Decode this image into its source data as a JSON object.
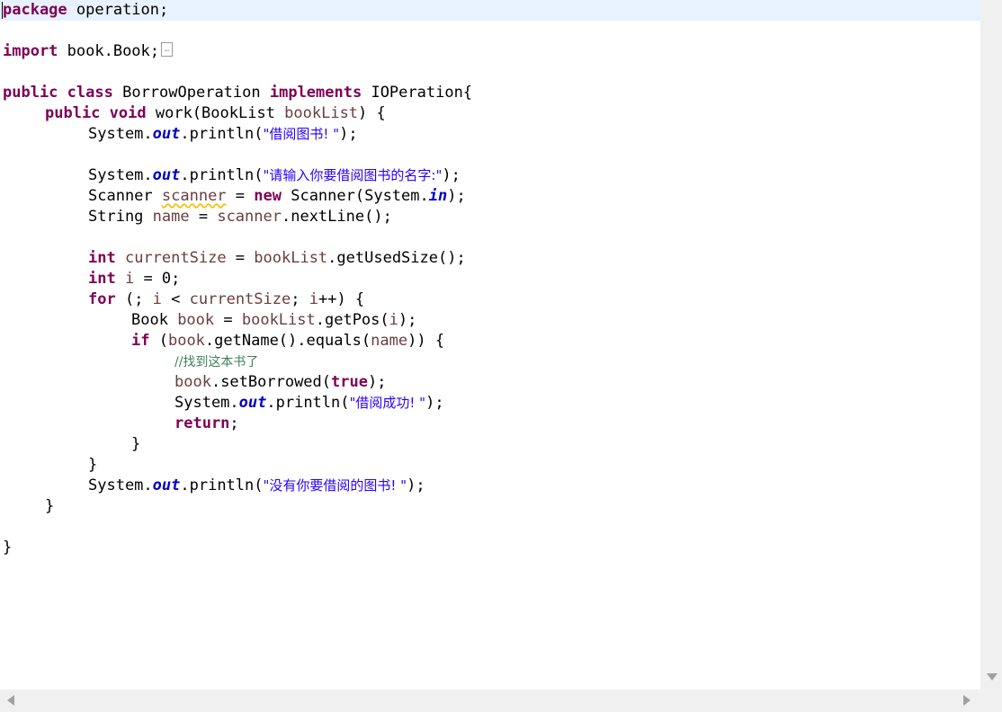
{
  "editor": {
    "l1": {
      "kw": "package",
      "rest": " operation;"
    },
    "l3": {
      "kw": "import",
      "rest": " book.Book;",
      "fold": "…"
    },
    "l5": {
      "kw1": "public",
      "kw2": "class",
      "name": " BorrowOperation ",
      "kw3": "implements",
      "rest": " IOPeration{"
    },
    "l6": {
      "kw1": "public",
      "kw2": "void",
      "a": " work(BookList ",
      "param": "bookList",
      "b": ") {"
    },
    "l7": {
      "a": "System.",
      "field": "out",
      "b": ".println(",
      "str": "\"借阅图书! \"",
      "c": ");"
    },
    "l9": {
      "a": "System.",
      "field": "out",
      "b": ".println(",
      "str": "\"请输入你要借阅图书的名字:\"",
      "c": ");"
    },
    "l10": {
      "a": "Scanner ",
      "var": "scanner",
      "b": " = ",
      "kw": "new",
      "c": " Scanner(System.",
      "field": "in",
      "d": ");"
    },
    "l11": {
      "a": "String ",
      "var1": "name",
      "b": " = ",
      "var2": "scanner",
      "c": ".nextLine();"
    },
    "l13": {
      "kw": "int",
      "sp": " ",
      "var1": "currentSize",
      "b": " = ",
      "var2": "bookList",
      "c": ".getUsedSize();"
    },
    "l14": {
      "kw": "int",
      "sp": " ",
      "var": "i",
      "b": " = 0;"
    },
    "l15": {
      "kw": "for",
      "a": " (; ",
      "var1": "i",
      "b": " < ",
      "var2": "currentSize",
      "c": "; ",
      "var3": "i",
      "d": "++) {"
    },
    "l16": {
      "a": "Book ",
      "var1": "book",
      "b": " = ",
      "var2": "bookList",
      "c": ".getPos(",
      "var3": "i",
      "d": ");"
    },
    "l17": {
      "kw": "if",
      "a": " (",
      "var1": "book",
      "b": ".getName().equals(",
      "var2": "name",
      "c": ")) {"
    },
    "l18": {
      "comment": "//找到这本书了"
    },
    "l19": {
      "var": "book",
      "a": ".setBorrowed(",
      "kw": "true",
      "b": ");"
    },
    "l20": {
      "a": "System.",
      "field": "out",
      "b": ".println(",
      "str": "\"借阅成功! \"",
      "c": ");"
    },
    "l21": {
      "kw": "return",
      "a": ";"
    },
    "l22": {
      "a": "}"
    },
    "l23": {
      "a": "}"
    },
    "l24": {
      "a": "System.",
      "field": "out",
      "b": ".println(",
      "str": "\"没有你要借阅的图书! \"",
      "c": ");"
    },
    "l25": {
      "a": "}"
    },
    "l27": {
      "a": "}"
    }
  },
  "colors": {
    "keyword": "#7f0055",
    "string": "#2a00ff",
    "field": "#0000c0",
    "local_variable": "#6a3e3e",
    "comment": "#3f7f5f",
    "current_line": "#e8f2fe"
  },
  "icons": {
    "fold": "folded-import-icon",
    "scroll_down": "scroll-down-arrow-icon",
    "scroll_left": "scroll-left-arrow-icon",
    "scroll_right": "scroll-right-arrow-icon"
  }
}
